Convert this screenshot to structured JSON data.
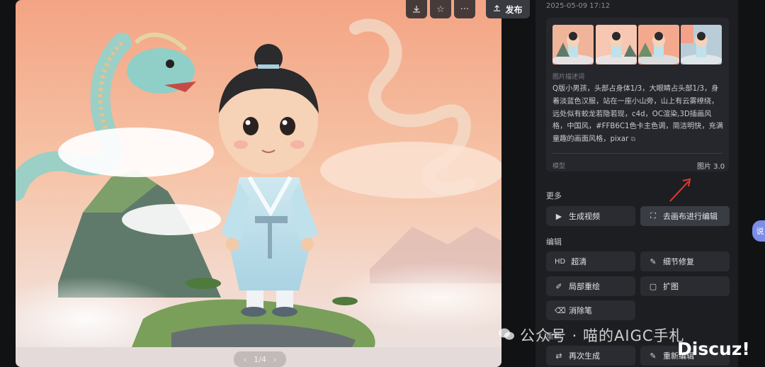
{
  "toolbar": {
    "download_icon": "download-icon",
    "star_icon": "star-icon",
    "more_icon": "more-icon",
    "publish_label": "发布"
  },
  "pager": {
    "text": "1/4"
  },
  "panel": {
    "timestamp": "2025-05-09 17:12",
    "description_label": "图片描述词",
    "description": "Q版小男孩，头部占身体1/3，大眼睛占头部1/3，身着淡蓝色汉服，站在一座小山旁，山上有云雾缭绕，远处似有蛟龙若隐若现，c4d，OC渲染,3D插画风格，中国风，#FFB6C1色卡主色调，简洁明快，充满童趣的画面风格，pixar",
    "model_label": "模型",
    "model_value": "图片 3.0",
    "sections": {
      "more": "更多",
      "edit": "编辑",
      "regen": "重新"
    },
    "buttons": {
      "gen_video": "生成视频",
      "canvas_edit": "去画布进行编辑",
      "hd": "超清",
      "hd_badge": "HD",
      "detail_fix": "细节修复",
      "partial_redraw": "局部重绘",
      "expand": "扩图",
      "eraser": "消除笔",
      "regenerate": "再次生成",
      "reedit": "重新编辑"
    }
  },
  "watermarks": {
    "wechat": "公众号 · 喵的AIGC手札",
    "discuz": "Discuz!"
  },
  "side_tab": "说"
}
